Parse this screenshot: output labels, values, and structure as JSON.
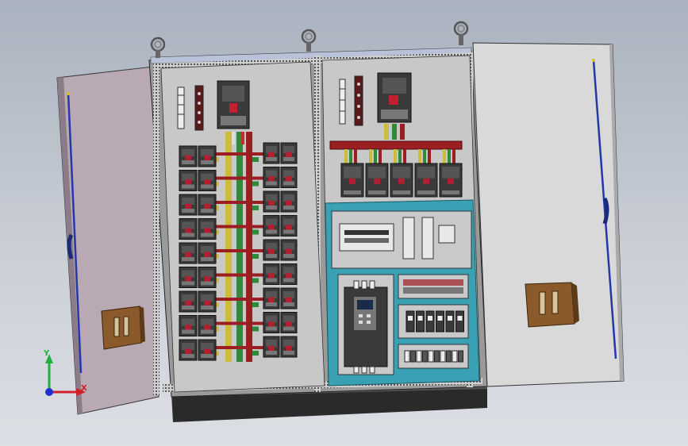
{
  "axes": {
    "x_label": "X",
    "y_label": "Y"
  },
  "colors": {
    "background_top": "#a9b2bf",
    "cabinet_gray": "#c8c8c8",
    "door_left": "#b9a9b4",
    "door_right": "#d9d9d9",
    "busbar_red": "#9b1e22",
    "busbar_yellow": "#cdbb3c",
    "busbar_green": "#2f8a3a",
    "subpanel_teal": "#3aa0b4",
    "handle_wood": "#8a5a2b",
    "door_rod_blue": "#2438a8",
    "axis_x": "#d0202a",
    "axis_y": "#20b040",
    "axis_z": "#2030d0"
  }
}
